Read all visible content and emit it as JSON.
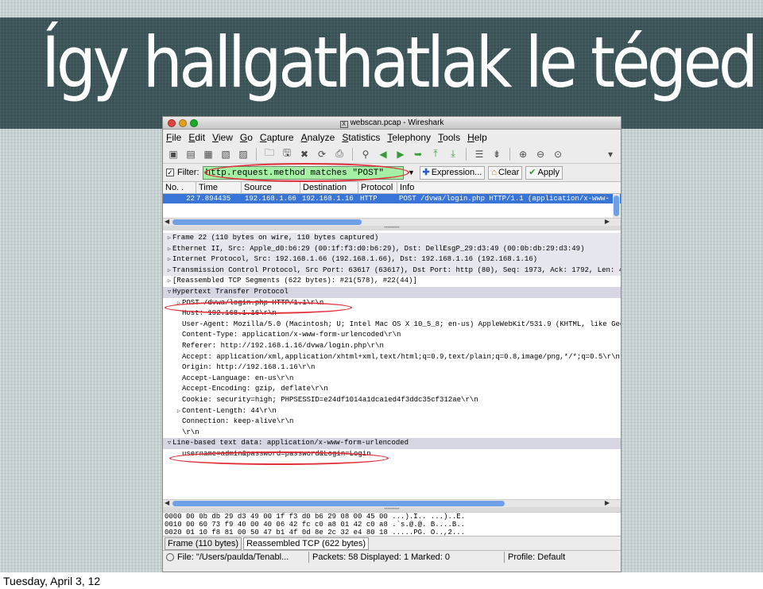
{
  "slide": {
    "title": "Így hallgathatlak le téged",
    "footer": "Tuesday, April 3, 12"
  },
  "window": {
    "title": "webscan.pcap - Wireshark",
    "menu": [
      "File",
      "Edit",
      "View",
      "Go",
      "Capture",
      "Analyze",
      "Statistics",
      "Telephony",
      "Tools",
      "Help"
    ]
  },
  "filter": {
    "label": "Filter:",
    "value": "http.request.method matches \"POST\"",
    "expression_label": "Expression...",
    "clear_label": "Clear",
    "apply_label": "Apply"
  },
  "packet_list": {
    "columns": [
      "No. .",
      "Time",
      "Source",
      "Destination",
      "Protocol",
      "Info"
    ],
    "selected_row": {
      "no": "22",
      "time": "7.894435",
      "source": "192.168.1.66",
      "destination": "192.168.1.16",
      "protocol": "HTTP",
      "info": "POST /dvwa/login.php HTTP/1.1  (application/x-www-"
    }
  },
  "details": [
    {
      "text": "Frame 22 (110 bytes on wire, 110 bytes captured)",
      "expand": "right",
      "style": "shaded",
      "indent": 0
    },
    {
      "text": "Ethernet II, Src: Apple_d0:b6:29 (00:1f:f3:d0:b6:29), Dst: DellEsgP_29:d3:49 (00:0b:db:29:d3:49)",
      "expand": "right",
      "style": "shaded",
      "indent": 0
    },
    {
      "text": "Internet Protocol, Src: 192.168.1.66 (192.168.1.66), Dst: 192.168.1.16 (192.168.1.16)",
      "expand": "right",
      "style": "shaded",
      "indent": 0
    },
    {
      "text": "Transmission Control Protocol, Src Port: 63617 (63617), Dst Port: http (80), Seq: 1973, Ack: 1792, Len: 4",
      "expand": "right",
      "style": "shaded",
      "indent": 0
    },
    {
      "text": "[Reassembled TCP Segments (622 bytes): #21(578), #22(44)]",
      "expand": "right",
      "style": "",
      "indent": 0
    },
    {
      "text": "Hypertext Transfer Protocol",
      "expand": "down",
      "style": "section",
      "indent": 0
    },
    {
      "text": "POST /dvwa/login.php HTTP/1.1\\r\\n",
      "expand": "right",
      "style": "",
      "indent": 1
    },
    {
      "text": "Host: 192.168.1.16\\r\\n",
      "expand": "",
      "style": "",
      "indent": 1
    },
    {
      "text": "User-Agent: Mozilla/5.0 (Macintosh; U; Intel Mac OS X 10_5_8; en-us) AppleWebKit/531.9 (KHTML, like Gec",
      "expand": "",
      "style": "",
      "indent": 1
    },
    {
      "text": "Content-Type: application/x-www-form-urlencoded\\r\\n",
      "expand": "",
      "style": "",
      "indent": 1
    },
    {
      "text": "Referer: http://192.168.1.16/dvwa/login.php\\r\\n",
      "expand": "",
      "style": "",
      "indent": 1
    },
    {
      "text": "Accept: application/xml,application/xhtml+xml,text/html;q=0.9,text/plain;q=0.8,image/png,*/*;q=0.5\\r\\n",
      "expand": "",
      "style": "",
      "indent": 1
    },
    {
      "text": "Origin: http://192.168.1.16\\r\\n",
      "expand": "",
      "style": "",
      "indent": 1
    },
    {
      "text": "Accept-Language: en-us\\r\\n",
      "expand": "",
      "style": "",
      "indent": 1
    },
    {
      "text": "Accept-Encoding: gzip, deflate\\r\\n",
      "expand": "",
      "style": "",
      "indent": 1
    },
    {
      "text": "Cookie: security=high; PHPSESSID=e24df1014a1dca1ed4f3ddc35cf312ae\\r\\n",
      "expand": "",
      "style": "",
      "indent": 1
    },
    {
      "text": "Content-Length: 44\\r\\n",
      "expand": "right",
      "style": "",
      "indent": 1
    },
    {
      "text": "Connection: keep-alive\\r\\n",
      "expand": "",
      "style": "",
      "indent": 1
    },
    {
      "text": "\\r\\n",
      "expand": "",
      "style": "",
      "indent": 1
    },
    {
      "text": "Line-based text data: application/x-www-form-urlencoded",
      "expand": "down",
      "style": "section",
      "indent": 0
    },
    {
      "text": "username=admin&password=password&Login=Login",
      "expand": "",
      "style": "",
      "indent": 1
    }
  ],
  "hex": [
    "0000  00 0b db 29 d3 49 00 1f  f3 d0 b6 29 08 00 45 00   ...).I.. ...)..E.",
    "0010  00 60 73 f9 40 00 40 06  42 fc c0 a8 01 42 c0 a8   .`s.@.@. B....B..",
    "0020  01 10 f8 81 00 50 47 b1  4f 0d 8e 2c 32 e4 80 18   .....PG. O..,2..."
  ],
  "tabs": [
    "Frame (110 bytes)",
    "Reassembled TCP (622 bytes)"
  ],
  "status": {
    "file": "File: \"/Users/paulda/Tenabl...",
    "packets": "Packets: 58 Displayed: 1 Marked: 0",
    "profile": "Profile: Default"
  }
}
